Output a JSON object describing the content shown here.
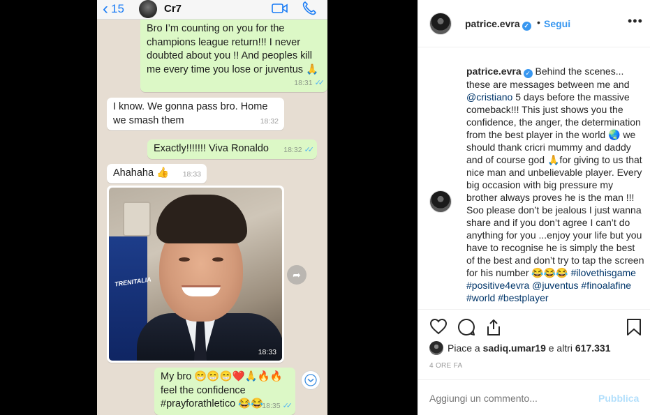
{
  "chat": {
    "back_count": "15",
    "contact_name": "Cr7",
    "messages": [
      {
        "text": "Bro I’m counting on you for the champions league return!!! I never doubted about you !! And peoples kill me every time you lose or juventus 🙏",
        "time": "18:31"
      },
      {
        "text": "I know. We gonna pass bro. Home we smash them",
        "time": "18:32"
      },
      {
        "text": "Exactly!!!!!!! Viva Ronaldo",
        "time": "18:32"
      },
      {
        "text": "Ahahaha 👍",
        "time": "18:33"
      },
      {
        "text": "My bro 😁😁😁❤️🙏🔥🔥 feel the confidence #prayforathletico 😂😂",
        "time": "18:35"
      }
    ],
    "image_time": "18:33",
    "image_seat_brand": "TRENITALIA"
  },
  "post": {
    "username": "patrice.evra",
    "follow_label": "Segui",
    "caption_parts": [
      "Behind the scenes... these are messages between me and ",
      "@cristiano",
      " 5 days before the massive comeback!!! This just shows you the confidence, the anger, the determination from the best player in the world 🌏 we should thank cricri mummy and daddy and of course god 🙏for giving to us that nice man and unbelievable player. Every big occasion with big pressure my brother always proves he is the man !!! Soo please don’t be jealous I just wanna share and if you don’t agree I can’t do anything for you ...enjoy your life but you have to recognise he is simply the best of the best and don’t try to tap the screen for his number 😂😂😂 ",
      "#ilovethisgame",
      " ",
      "#positive4evra",
      " ",
      "@juventus",
      " ",
      "#finoalafine",
      " ",
      "#world",
      " ",
      "#bestplayer"
    ],
    "likes_prefix": "Piace a ",
    "likes_user": "sadiq.umar19",
    "likes_middle": " e altri ",
    "likes_count": "617.331",
    "time_ago": "4 ORE FA",
    "comment_placeholder": "Aggiungi un commento...",
    "publish_label": "Pubblica"
  },
  "icons": [
    "heart-icon",
    "comment-icon",
    "share-icon",
    "bookmark-icon",
    "more-icon",
    "verified-icon",
    "video-call-icon",
    "phone-icon",
    "forward-icon",
    "chevron-down-icon"
  ],
  "colors": {
    "whatsapp_outgoing": "#dcf8c6",
    "instagram_blue": "#3897f0",
    "read_ticks": "#4fb3f4"
  }
}
